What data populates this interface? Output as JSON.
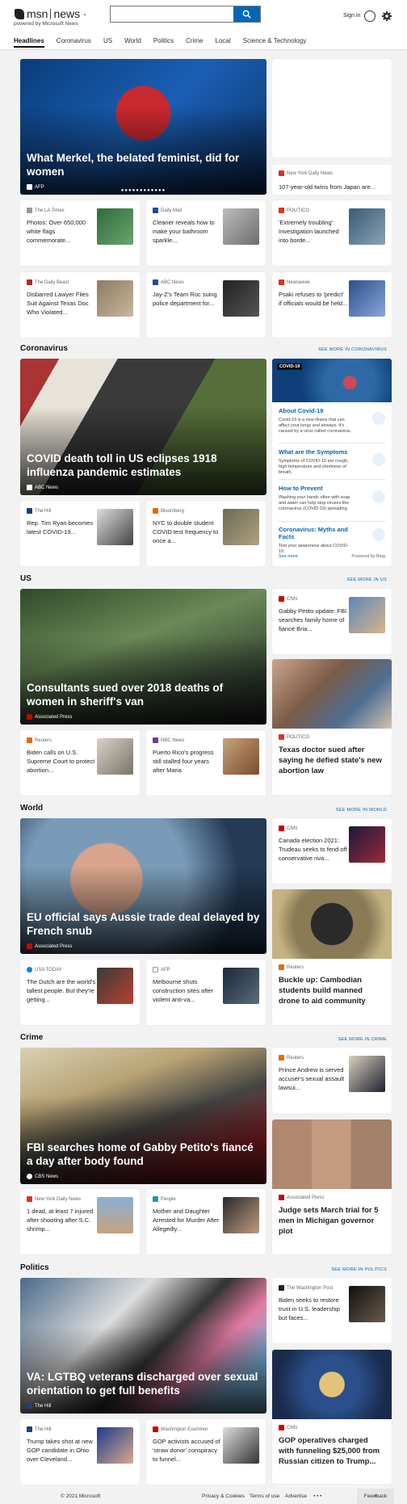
{
  "header": {
    "brand": "msn",
    "brand_section": "news",
    "powered_by": "powered by Microsoft News",
    "search_placeholder": "",
    "sign_in": "Sign in"
  },
  "nav": [
    "Headlines",
    "Coronavirus",
    "US",
    "World",
    "Politics",
    "Crime",
    "Local",
    "Science & Technology"
  ],
  "headlines": {
    "hero": {
      "title": "What Merkel, the belated feminist, did for women",
      "source": "AFP"
    },
    "side_top": {
      "source": "New York Daily News",
      "title": "107-year-old twins from Japan are..."
    },
    "small": [
      {
        "source": "The LA Times",
        "title": "Photos: Over 650,000 white flags commemorate..."
      },
      {
        "source": "Daily Mail",
        "title": "Cleaner reveals how to make your bathroom sparkle..."
      },
      {
        "source": "POLITICO",
        "title": "'Extremely troubling': Investigation launched into borde..."
      },
      {
        "source": "The Daily Beast",
        "title": "Disbarred Lawyer Files Suit Against Texas Doc Who Violated..."
      },
      {
        "source": "ABC News",
        "title": "Jay-Z's Team Roc suing police department for..."
      },
      {
        "source": "Newsweek",
        "title": "Psaki refuses to 'predict' if officials would be held..."
      }
    ]
  },
  "coronavirus": {
    "section": "Coronavirus",
    "see_more": "SEE MORE IN CORONAVIRUS",
    "hero": {
      "title": "COVID death toll in US eclipses 1918 influenza pandemic estimates",
      "source": "ABC News"
    },
    "small": [
      {
        "source": "The Hill",
        "title": "Rep. Tim Ryan becomes latest COVID-19..."
      },
      {
        "source": "Bloomberg",
        "title": "NYC to double student COVID test frequency to once a..."
      }
    ],
    "panel": {
      "badge": "COVID-19",
      "items": [
        {
          "title": "About Covid-19",
          "desc": "Covid-19 is a new illness that can affect your lungs and airways. It's caused by a virus called coronavirus."
        },
        {
          "title": "What are the Symptoms",
          "desc": "Symptoms of COVID-19 are cough, high temperature and shortness of breath."
        },
        {
          "title": "How to Prevent",
          "desc": "Washing your hands often with soap and water can help stop viruses like coronavirus (COVID-19) spreading."
        },
        {
          "title": "Coronavirus: Myths and Facts",
          "desc": "Test your awareness about COVID-19."
        }
      ],
      "see_more": "See more",
      "powered": "Powered by Bing"
    }
  },
  "us": {
    "section": "US",
    "see_more": "SEE MORE IN US",
    "hero": {
      "title": "Consultants sued over 2018 deaths of women in sheriff's van",
      "source": "Associated Press"
    },
    "side_small": {
      "source": "CNN",
      "title": "Gabby Petito update: FBI searches family home of fiancé Bria..."
    },
    "side_big": {
      "source": "POLITICO",
      "title": "Texas doctor sued after saying he defied state's new abortion law"
    },
    "small": [
      {
        "source": "Reuters",
        "title": "Biden calls on U.S. Supreme Court to protect abortion..."
      },
      {
        "source": "NBC News",
        "title": "Puerto Rico's progress still stalled four years after Maria"
      }
    ]
  },
  "world": {
    "section": "World",
    "see_more": "SEE MORE IN WORLD",
    "hero": {
      "title": "EU official says Aussie trade deal delayed by French snub",
      "source": "Associated Press"
    },
    "side_small": {
      "source": "CNN",
      "title": "Canada election 2021: Trudeau seeks to fend off conservative riva..."
    },
    "side_big": {
      "source": "Reuters",
      "title": "Buckle up: Cambodian students build manned drone to aid community"
    },
    "small": [
      {
        "source": "USA TODAY",
        "title": "The Dutch are the world's tallest people. But they're getting..."
      },
      {
        "source": "AFP",
        "title": "Melbourne shuts construction sites after violent anti-va..."
      }
    ]
  },
  "crime": {
    "section": "Crime",
    "see_more": "SEE MORE IN CRIME",
    "hero": {
      "title": "FBI searches home of Gabby Petito's fiancé a day after body found",
      "source": "CBS News"
    },
    "side_small": {
      "source": "Reuters",
      "title": "Prince Andrew is served accuser's sexual assault lawsui..."
    },
    "side_big": {
      "source": "Associated Press",
      "title": "Judge sets March trial for 5 men in Michigan governor plot"
    },
    "small": [
      {
        "source": "New York Daily News",
        "title": "1 dead, at least 7 injured after shooting after S.C. shrimp..."
      },
      {
        "source": "People",
        "title": "Mother and Daughter Arrested for Murder After Allegedly..."
      }
    ]
  },
  "politics": {
    "section": "Politics",
    "see_more": "SEE MORE IN POLITICS",
    "hero": {
      "title": "VA: LGTBQ veterans discharged over sexual orientation to get full benefits",
      "source": "The Hill"
    },
    "side_small": {
      "source": "The Washington Post",
      "title": "Biden seeks to restore trust in U.S. leadership but faces..."
    },
    "side_big": {
      "source": "CNN",
      "title": "GOP operatives charged with funneling $25,000 from Russian citizen to Trump..."
    },
    "small": [
      {
        "source": "The Hill",
        "title": "Trump takes shot at new GOP candidate in Ohio over Cleveland..."
      },
      {
        "source": "Washington Examiner",
        "title": "GOP activists accused of 'straw donor' conspiracy to funnel..."
      }
    ]
  },
  "footer": {
    "copyright": "© 2021 Microsoft",
    "privacy": "Privacy & Cookies",
    "terms": "Terms of use",
    "advertise": "Advertise",
    "more": "• • •",
    "feedback": "Feedback"
  },
  "colors": {
    "accent": "#0067b8"
  }
}
